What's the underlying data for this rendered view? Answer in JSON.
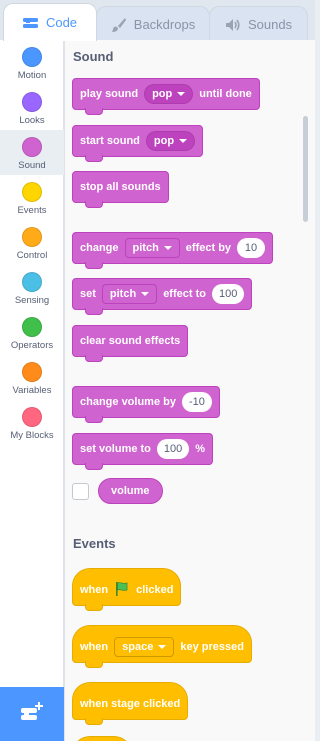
{
  "tabs": [
    {
      "label": "Code",
      "icon": "code-icon",
      "active": true
    },
    {
      "label": "Backdrops",
      "icon": "paintbrush-icon",
      "active": false
    },
    {
      "label": "Sounds",
      "icon": "speaker-icon",
      "active": false
    }
  ],
  "categories": [
    {
      "label": "Motion",
      "color": "#4c97ff"
    },
    {
      "label": "Looks",
      "color": "#9966ff"
    },
    {
      "label": "Sound",
      "color": "#cf63cf",
      "selected": true
    },
    {
      "label": "Events",
      "color": "#ffd500"
    },
    {
      "label": "Control",
      "color": "#ffab19"
    },
    {
      "label": "Sensing",
      "color": "#4cbfe6"
    },
    {
      "label": "Operators",
      "color": "#40bf4a"
    },
    {
      "label": "Variables",
      "color": "#ff8c1a"
    },
    {
      "label": "My Blocks",
      "color": "#ff6680"
    }
  ],
  "extension_button": {
    "icon": "add-extension-icon"
  },
  "sound": {
    "title": "Sound",
    "play_sound": {
      "prefix": "play sound",
      "sound": "pop",
      "suffix": "until done"
    },
    "start_sound": {
      "prefix": "start sound",
      "sound": "pop"
    },
    "stop_all": "stop all sounds",
    "change_effect": {
      "prefix": "change",
      "effect": "pitch",
      "middle": "effect by",
      "value": "10"
    },
    "set_effect": {
      "prefix": "set",
      "effect": "pitch",
      "middle": "effect to",
      "value": "100"
    },
    "clear_effects": "clear sound effects",
    "change_volume": {
      "prefix": "change volume by",
      "value": "-10"
    },
    "set_volume": {
      "prefix": "set volume to",
      "value": "100",
      "suffix": "%"
    },
    "volume_reporter": "volume"
  },
  "events": {
    "title": "Events",
    "when_flag": {
      "prefix": "when",
      "suffix": "clicked"
    },
    "when_key": {
      "prefix": "when",
      "key": "space",
      "suffix": "key pressed"
    },
    "when_stage": "when stage clicked"
  },
  "colors": {
    "sound": "#cf63cf",
    "events": "#ffbf00",
    "accent": "#4c97ff"
  }
}
